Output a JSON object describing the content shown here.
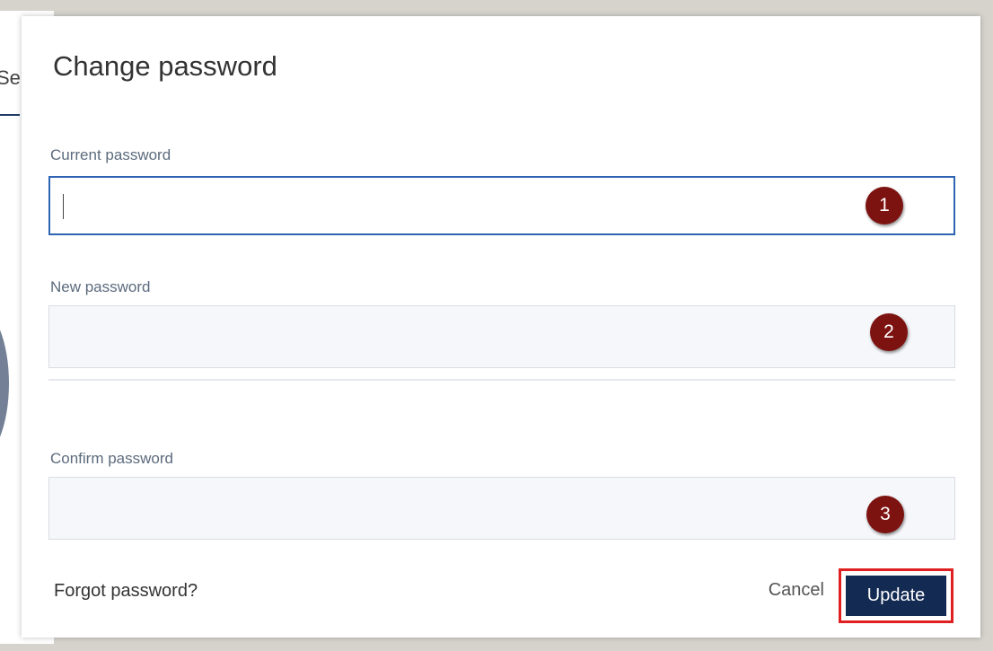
{
  "background_page": {
    "partial_text": "Se"
  },
  "dialog": {
    "title": "Change password",
    "fields": [
      {
        "label": "Current password",
        "value": "",
        "step": "1",
        "focused": true
      },
      {
        "label": "New password",
        "value": "",
        "step": "2",
        "focused": false
      },
      {
        "label": "Confirm password",
        "value": "",
        "step": "3",
        "focused": false
      }
    ],
    "forgot_link": "Forgot password?",
    "cancel_label": "Cancel",
    "update_label": "Update"
  },
  "colors": {
    "badge": "#7d1310",
    "primary_button": "#132a52",
    "focus_border": "#2f64b3",
    "highlight_border": "#e02020"
  }
}
